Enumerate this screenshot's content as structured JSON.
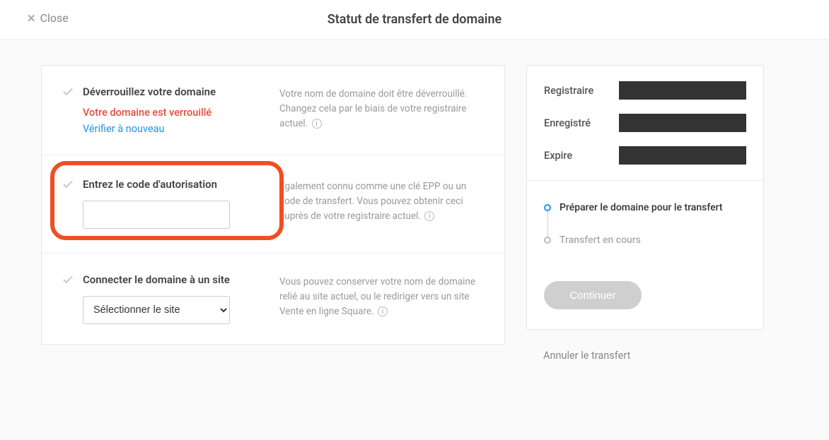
{
  "header": {
    "close_label": "Close",
    "title": "Statut de transfert de domaine"
  },
  "steps": {
    "unlock": {
      "title": "Déverrouillez votre domaine",
      "locked_msg": "Votre domaine est verrouillé",
      "verify_link": "Vérifier à nouveau",
      "desc": "Votre nom de domaine doit être déverrouillé. Changez cela par le biais de votre registraire actuel."
    },
    "auth": {
      "title": "Entrez le code d'autorisation",
      "desc": "Egalement connu comme une clé EPP ou un code de transfert. Vous pouvez obtenir ceci auprès de votre registraire actuel.",
      "input_value": ""
    },
    "connect": {
      "title": "Connecter le domaine à un site",
      "desc": "Vous pouvez conserver votre nom de domaine relié au site actuel, ou le rediriger vers un site Vente en ligne Square.",
      "select_placeholder": "Sélectionner le site"
    }
  },
  "sidebar": {
    "info": {
      "registrar_label": "Registraire",
      "registered_label": "Enregistré",
      "expires_label": "Expire"
    },
    "progress": {
      "step1": "Préparer le domaine pour le transfert",
      "step2": "Transfert en cours"
    },
    "continue_label": "Continuer",
    "cancel_label": "Annuler le transfert"
  }
}
